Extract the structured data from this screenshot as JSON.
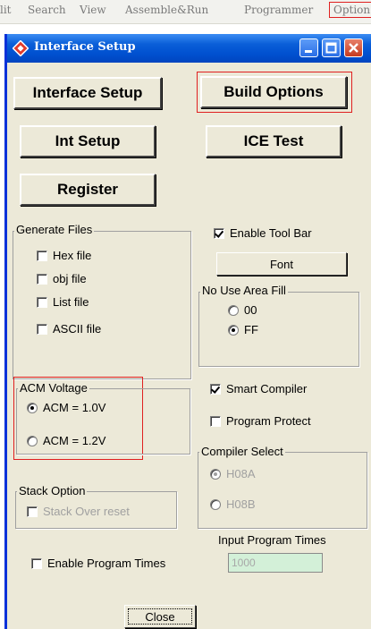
{
  "menubar": {
    "items": [
      "lit",
      "Search",
      "View",
      "Assemble&Run",
      "Programmer",
      "Option"
    ]
  },
  "window": {
    "title": "Interface Setup",
    "app_icon": "diamond-app-icon",
    "controls": [
      "minimize-icon",
      "maximize-icon",
      "close-icon"
    ]
  },
  "buttons": {
    "interface_setup": "Interface Setup",
    "build_options": "Build Options",
    "int_setup": "Int Setup",
    "ice_test": "ICE Test",
    "register": "Register",
    "font": "Font",
    "close": "Close"
  },
  "generate_files": {
    "title": "Generate Files",
    "items": [
      {
        "label": "Hex file",
        "checked": false
      },
      {
        "label": "obj file",
        "checked": false
      },
      {
        "label": "List file",
        "checked": false
      },
      {
        "label": "ASCII file",
        "checked": false
      }
    ]
  },
  "enable_tool_bar": {
    "label": "Enable Tool Bar",
    "checked": true
  },
  "no_use_area_fill": {
    "title": "No Use Area Fill",
    "options": [
      {
        "label": "00",
        "selected": false
      },
      {
        "label": "FF",
        "selected": true
      }
    ]
  },
  "acm_voltage": {
    "title": "ACM Voltage",
    "options": [
      {
        "label": "ACM = 1.0V",
        "selected": true
      },
      {
        "label": "ACM = 1.2V",
        "selected": false
      }
    ]
  },
  "smart_compiler": {
    "label": "Smart Compiler",
    "checked": true
  },
  "program_protect": {
    "label": "Program Protect",
    "checked": false
  },
  "compiler_select": {
    "title": "Compiler Select",
    "options": [
      {
        "label": "H08A",
        "selected": true,
        "disabled": true
      },
      {
        "label": "H08B",
        "selected": false,
        "disabled": true
      }
    ]
  },
  "stack_option": {
    "title": "Stack Option",
    "stack_over_reset": {
      "label": "Stack Over reset",
      "checked": false,
      "disabled": true
    }
  },
  "enable_program_times": {
    "label": "Enable Program Times",
    "checked": false
  },
  "input_program_times": {
    "label": "Input Program Times",
    "value": "1000"
  },
  "colors": {
    "title_bar": "#0054e3",
    "dialog_bg": "#ece9d8",
    "highlight_border": "#e02020",
    "disabled_input_bg": "#d3f0d8"
  }
}
